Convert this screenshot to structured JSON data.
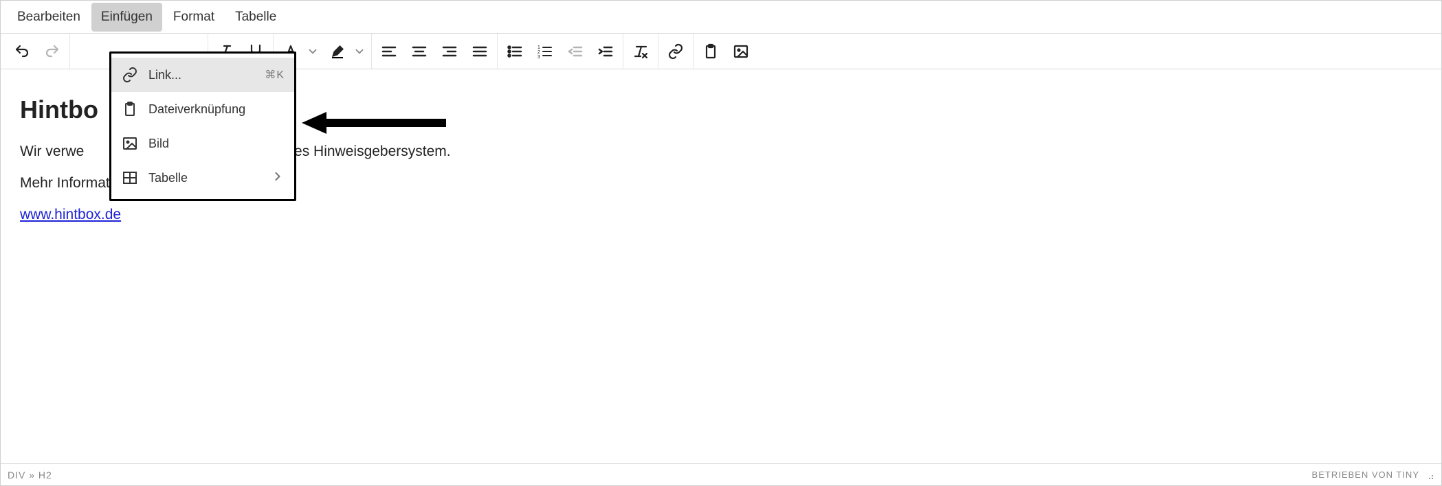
{
  "menubar": {
    "items": [
      "Bearbeiten",
      "Einfügen",
      "Format",
      "Tabelle"
    ],
    "open_index": 1
  },
  "dropdown": {
    "items": [
      {
        "icon": "link-icon",
        "label": "Link...",
        "shortcut": "⌘K",
        "hover": true
      },
      {
        "icon": "paste-icon",
        "label": "Dateiverknüpfung"
      },
      {
        "icon": "image-icon",
        "label": "Bild"
      },
      {
        "icon": "table-icon",
        "label": "Tabelle",
        "submenu": true
      }
    ]
  },
  "content": {
    "heading": "Hintbo",
    "p1_visible": "Wir verwe",
    "p1_rest": "igitales Hinweisgebersystem.",
    "p2": "Mehr Informationen unter:",
    "link_text": "www.hintbox.de"
  },
  "statusbar": {
    "path": "DIV » H2",
    "powered": "BETRIEBEN VON TINY"
  }
}
